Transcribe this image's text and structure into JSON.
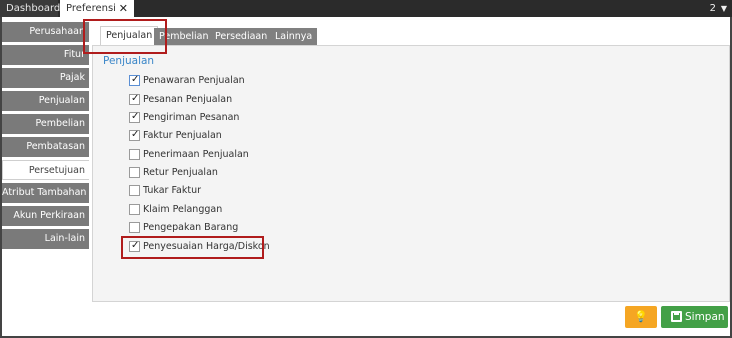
{
  "window_tabs": {
    "dashboard": "Dashboard",
    "preferensi": "Preferensi",
    "close": "✕",
    "count": "2"
  },
  "sidebar": {
    "items": [
      {
        "label": "Perusahaan",
        "active": false
      },
      {
        "label": "Fitur",
        "active": false
      },
      {
        "label": "Pajak",
        "active": false
      },
      {
        "label": "Penjualan",
        "active": false
      },
      {
        "label": "Pembelian",
        "active": false
      },
      {
        "label": "Pembatasan",
        "active": false
      },
      {
        "label": "Persetujuan",
        "active": true
      },
      {
        "label": "Atribut Tambahan",
        "active": false
      },
      {
        "label": "Akun Perkiraan",
        "active": false
      },
      {
        "label": "Lain-lain",
        "active": false
      }
    ]
  },
  "inner_tabs": [
    "Penjualan",
    "Pembelian",
    "Persediaan",
    "Lainnya"
  ],
  "section": {
    "title": "Penjualan",
    "options": [
      {
        "label": "Penawaran Penjualan",
        "checked": true
      },
      {
        "label": "Pesanan Penjualan",
        "checked": true
      },
      {
        "label": "Pengiriman Pesanan",
        "checked": true
      },
      {
        "label": "Faktur Penjualan",
        "checked": true
      },
      {
        "label": "Penerimaan Penjualan",
        "checked": false
      },
      {
        "label": "Retur Penjualan",
        "checked": false
      },
      {
        "label": "Tukar Faktur",
        "checked": false
      },
      {
        "label": "Klaim Pelanggan",
        "checked": false
      },
      {
        "label": "Pengepakan Barang",
        "checked": false
      },
      {
        "label": "Penyesuaian Harga/Diskon",
        "checked": true
      }
    ]
  },
  "buttons": {
    "save": "Simpan"
  },
  "colors": {
    "accent": "#3a86c8",
    "save": "#43a047",
    "tip": "#f5a623",
    "highlight": "#b01c1c"
  }
}
